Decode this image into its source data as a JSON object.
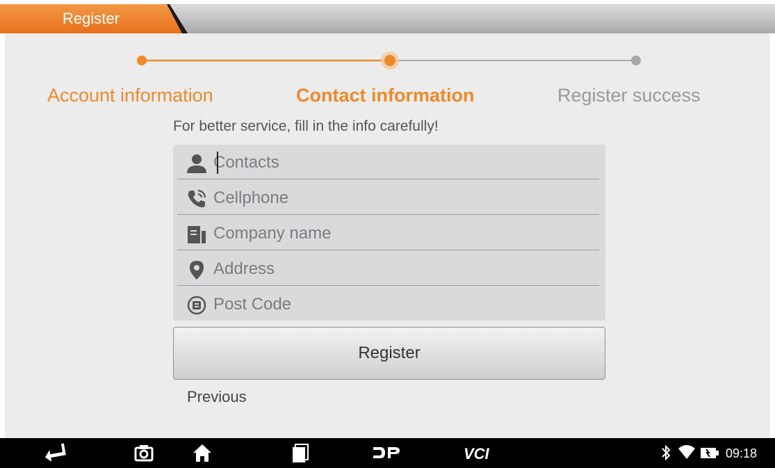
{
  "window": {
    "tab_title": "Register"
  },
  "stepper": {
    "steps": [
      {
        "label": "Account information",
        "state": "done"
      },
      {
        "label": "Contact information",
        "state": "active"
      },
      {
        "label": "Register success",
        "state": "todo"
      }
    ],
    "accent_color": "#ec8a2b",
    "inactive_color": "#9a9a9a"
  },
  "hint": "For better service, fill in the info carefully!",
  "form": {
    "fields": [
      {
        "icon": "person-icon",
        "placeholder": "Contacts",
        "value": ""
      },
      {
        "icon": "phone-icon",
        "placeholder": "Cellphone",
        "value": ""
      },
      {
        "icon": "company-icon",
        "placeholder": "Company name",
        "value": ""
      },
      {
        "icon": "location-pin-icon",
        "placeholder": "Address",
        "value": ""
      },
      {
        "icon": "postcode-icon",
        "placeholder": "Post Code",
        "value": ""
      }
    ]
  },
  "actions": {
    "register_label": "Register",
    "previous_label": "Previous"
  },
  "systembar": {
    "icons": [
      "back-icon",
      "camera-icon",
      "home-icon",
      "recent-apps-icon",
      "dp-icon",
      "vci-icon",
      "bluetooth-icon",
      "wifi-icon",
      "battery-icon"
    ],
    "vci_label": "VCI",
    "clock": "09:18"
  }
}
